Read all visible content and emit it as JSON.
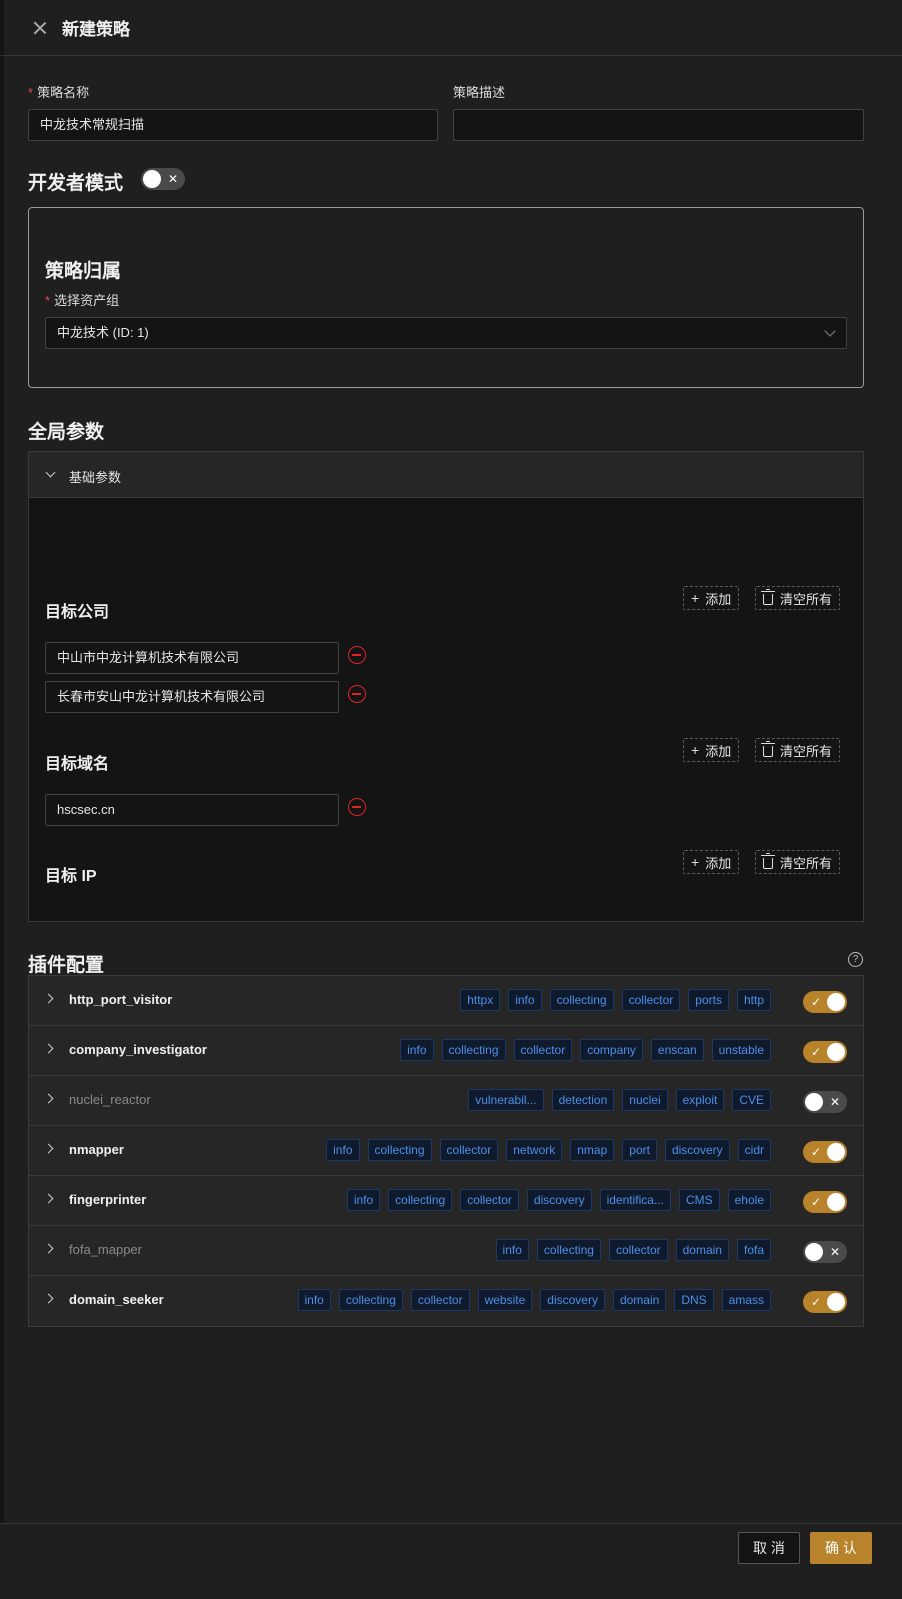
{
  "header": {
    "title": "新建策略"
  },
  "form": {
    "name_label": "策略名称",
    "name_value": "中龙技术常规扫描",
    "desc_label": "策略描述",
    "desc_value": ""
  },
  "dev_mode": {
    "label": "开发者模式",
    "enabled": false,
    "off_mark": "✕"
  },
  "ownership": {
    "title": "策略归属",
    "asset_group_label": "选择资产组",
    "asset_group_value": "中龙技术 (ID: 1)"
  },
  "global_params": {
    "title": "全局参数",
    "panel_label": "基础参数",
    "add_label": "添加",
    "clear_label": "清空所有",
    "target_company": {
      "title": "目标公司",
      "items": [
        "中山市中龙计算机技术有限公司",
        "长春市安山中龙计算机技术有限公司"
      ]
    },
    "target_domain": {
      "title": "目标域名",
      "items": [
        "hscsec.cn"
      ]
    },
    "target_ip": {
      "title": "目标 IP",
      "items": []
    }
  },
  "plugins": {
    "title": "插件配置",
    "help_icon": "?",
    "on_mark": "✓",
    "off_mark": "✕",
    "items": [
      {
        "name": "http_port_visitor",
        "enabled": true,
        "tags": [
          "httpx",
          "info",
          "collecting",
          "collector",
          "ports",
          "http"
        ]
      },
      {
        "name": "company_investigator",
        "enabled": true,
        "tags": [
          "info",
          "collecting",
          "collector",
          "company",
          "enscan",
          "unstable"
        ]
      },
      {
        "name": "nuclei_reactor",
        "enabled": false,
        "tags": [
          "vulnerabil...",
          "detection",
          "nuclei",
          "exploit",
          "CVE"
        ]
      },
      {
        "name": "nmapper",
        "enabled": true,
        "tags": [
          "info",
          "collecting",
          "collector",
          "network",
          "nmap",
          "port",
          "discovery",
          "cidr"
        ]
      },
      {
        "name": "fingerprinter",
        "enabled": true,
        "tags": [
          "info",
          "collecting",
          "collector",
          "discovery",
          "identifica...",
          "CMS",
          "ehole"
        ]
      },
      {
        "name": "fofa_mapper",
        "enabled": false,
        "tags": [
          "info",
          "collecting",
          "collector",
          "domain",
          "fofa"
        ]
      },
      {
        "name": "domain_seeker",
        "enabled": true,
        "tags": [
          "info",
          "collecting",
          "collector",
          "website",
          "discovery",
          "domain",
          "DNS",
          "amass"
        ]
      }
    ]
  },
  "footer": {
    "cancel_label": "取 消",
    "ok_label": "确 认"
  },
  "colors": {
    "accent": "#b8832a",
    "tag_text": "#4d8fe8",
    "danger": "#e02424",
    "background": "#1f1f1f"
  }
}
